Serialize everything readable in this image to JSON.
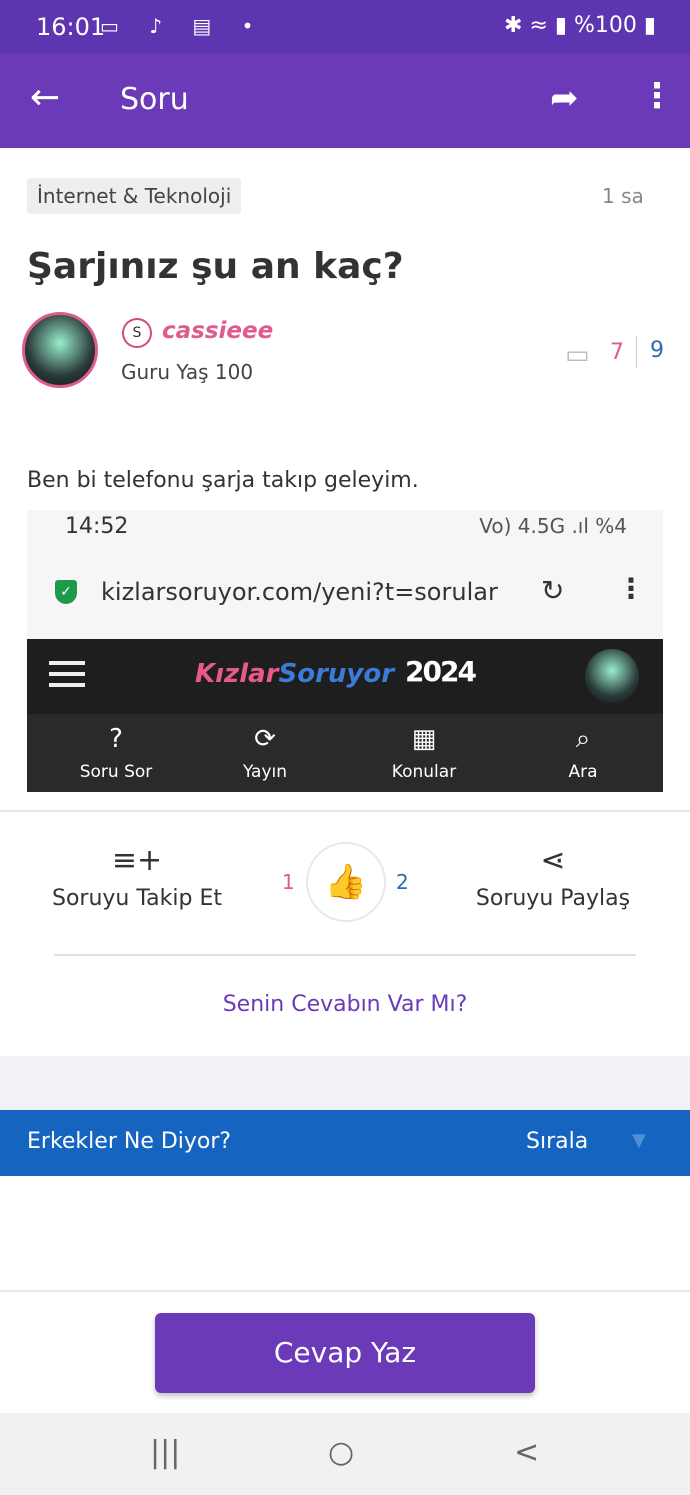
{
  "status_bar": {
    "time": "16:01",
    "left_icons": "▭ ♪ ▤ •",
    "battery": "%100"
  },
  "app_bar": {
    "title": "Soru",
    "back_icon": "←",
    "share_icon": "➦",
    "more_icon": "⋮"
  },
  "question": {
    "category": "İnternet & Teknoloji",
    "time_ago": "1 sa",
    "title": "Şarjınız şu an kaç?",
    "author": {
      "badge": "S",
      "name": "cassieee",
      "level": "Guru Yaş 100"
    },
    "stats": {
      "comments": "7",
      "other": "9"
    },
    "body": "Ben bi telefonu şarja takıp geleyim."
  },
  "embedded_screenshot": {
    "time": "14:52",
    "status_right": "Vo) 4.5G .ıl %4",
    "url": "kizlarsoruyor.com/yeni?t=sorular",
    "logo_part1": "Kızlar",
    "logo_part2": "Soruyor",
    "logo_year": "2024",
    "nav": [
      {
        "icon": "?",
        "label": "Soru Sor"
      },
      {
        "icon": "⟳",
        "label": "Yayın"
      },
      {
        "icon": "▦",
        "label": "Konular"
      },
      {
        "icon": "⌕",
        "label": "Ara"
      }
    ]
  },
  "actions": {
    "follow": {
      "icon": "≡+",
      "label": "Soruyu Takip Et"
    },
    "likes": "1",
    "dislikes": "2",
    "like_icon": "👍",
    "share": {
      "icon": "⋖",
      "label": "Soruyu Paylaş"
    }
  },
  "answer_prompt": "Senin Cevabın Var Mı?",
  "section": {
    "title": "Erkekler Ne Diyor?",
    "sort_label": "Sırala",
    "sort_icon": "▼"
  },
  "cta": "Cevap Yaz",
  "system_nav": {
    "recents": "|||",
    "home": "○",
    "back": "<"
  },
  "colors": {
    "primary": "#6a3ab9",
    "status_bar": "#5e35b1",
    "pink": "#e05a8e",
    "blue": "#1565c0"
  }
}
